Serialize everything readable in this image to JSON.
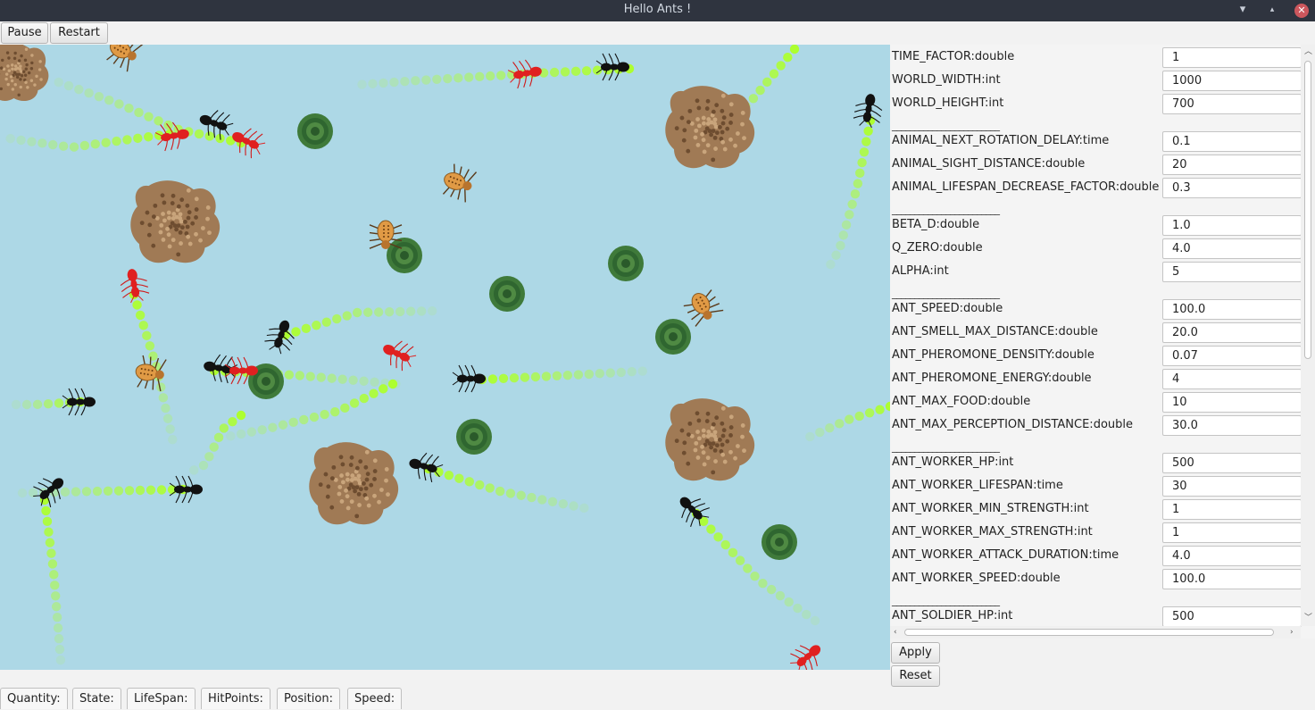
{
  "window": {
    "title": "Hello Ants !",
    "minimize": "▾",
    "maximize": "▴",
    "close": "✕"
  },
  "toolbar": {
    "pause_label": "Pause",
    "restart_label": "Restart"
  },
  "world": {
    "background": "#add8e6",
    "trail_color": "#adff2f",
    "icons": [
      "ant-icon",
      "food-icon",
      "nest-icon",
      "spider-icon"
    ]
  },
  "params": [
    {
      "label": "TIME_FACTOR:double",
      "value": "1"
    },
    {
      "label": "WORLD_WIDTH:int",
      "value": "1000"
    },
    {
      "label": "WORLD_HEIGHT:int",
      "value": "700"
    },
    {
      "sep": "________________________"
    },
    {
      "label": "ANIMAL_NEXT_ROTATION_DELAY:time",
      "value": "0.1"
    },
    {
      "label": "ANIMAL_SIGHT_DISTANCE:double",
      "value": "20"
    },
    {
      "label": "ANIMAL_LIFESPAN_DECREASE_FACTOR:double",
      "value": "0.3"
    },
    {
      "sep": "________________________"
    },
    {
      "label": "BETA_D:double",
      "value": "1.0"
    },
    {
      "label": "Q_ZERO:double",
      "value": "4.0"
    },
    {
      "label": "ALPHA:int",
      "value": "5"
    },
    {
      "sep": "________________________"
    },
    {
      "label": "ANT_SPEED:double",
      "value": "100.0"
    },
    {
      "label": "ANT_SMELL_MAX_DISTANCE:double",
      "value": "20.0"
    },
    {
      "label": "ANT_PHEROMONE_DENSITY:double",
      "value": "0.07"
    },
    {
      "label": "ANT_PHEROMONE_ENERGY:double",
      "value": "4"
    },
    {
      "label": "ANT_MAX_FOOD:double",
      "value": "10"
    },
    {
      "label": "ANT_MAX_PERCEPTION_DISTANCE:double",
      "value": "30.0"
    },
    {
      "sep": "________________________"
    },
    {
      "label": "ANT_WORKER_HP:int",
      "value": "500"
    },
    {
      "label": "ANT_WORKER_LIFESPAN:time",
      "value": "30"
    },
    {
      "label": "ANT_WORKER_MIN_STRENGTH:int",
      "value": "1"
    },
    {
      "label": "ANT_WORKER_MAX_STRENGTH:int",
      "value": "1"
    },
    {
      "label": "ANT_WORKER_ATTACK_DURATION:time",
      "value": "4.0"
    },
    {
      "label": "ANT_WORKER_SPEED:double",
      "value": "100.0"
    },
    {
      "sep": "________________________"
    },
    {
      "label": "ANT_SOLDIER_HP:int",
      "value": "500"
    }
  ],
  "actions": {
    "apply_label": "Apply",
    "reset_label": "Reset"
  },
  "statusbar": [
    "Quantity:",
    "State:",
    "LifeSpan:",
    "HitPoints:",
    "Position:",
    "Speed:"
  ]
}
